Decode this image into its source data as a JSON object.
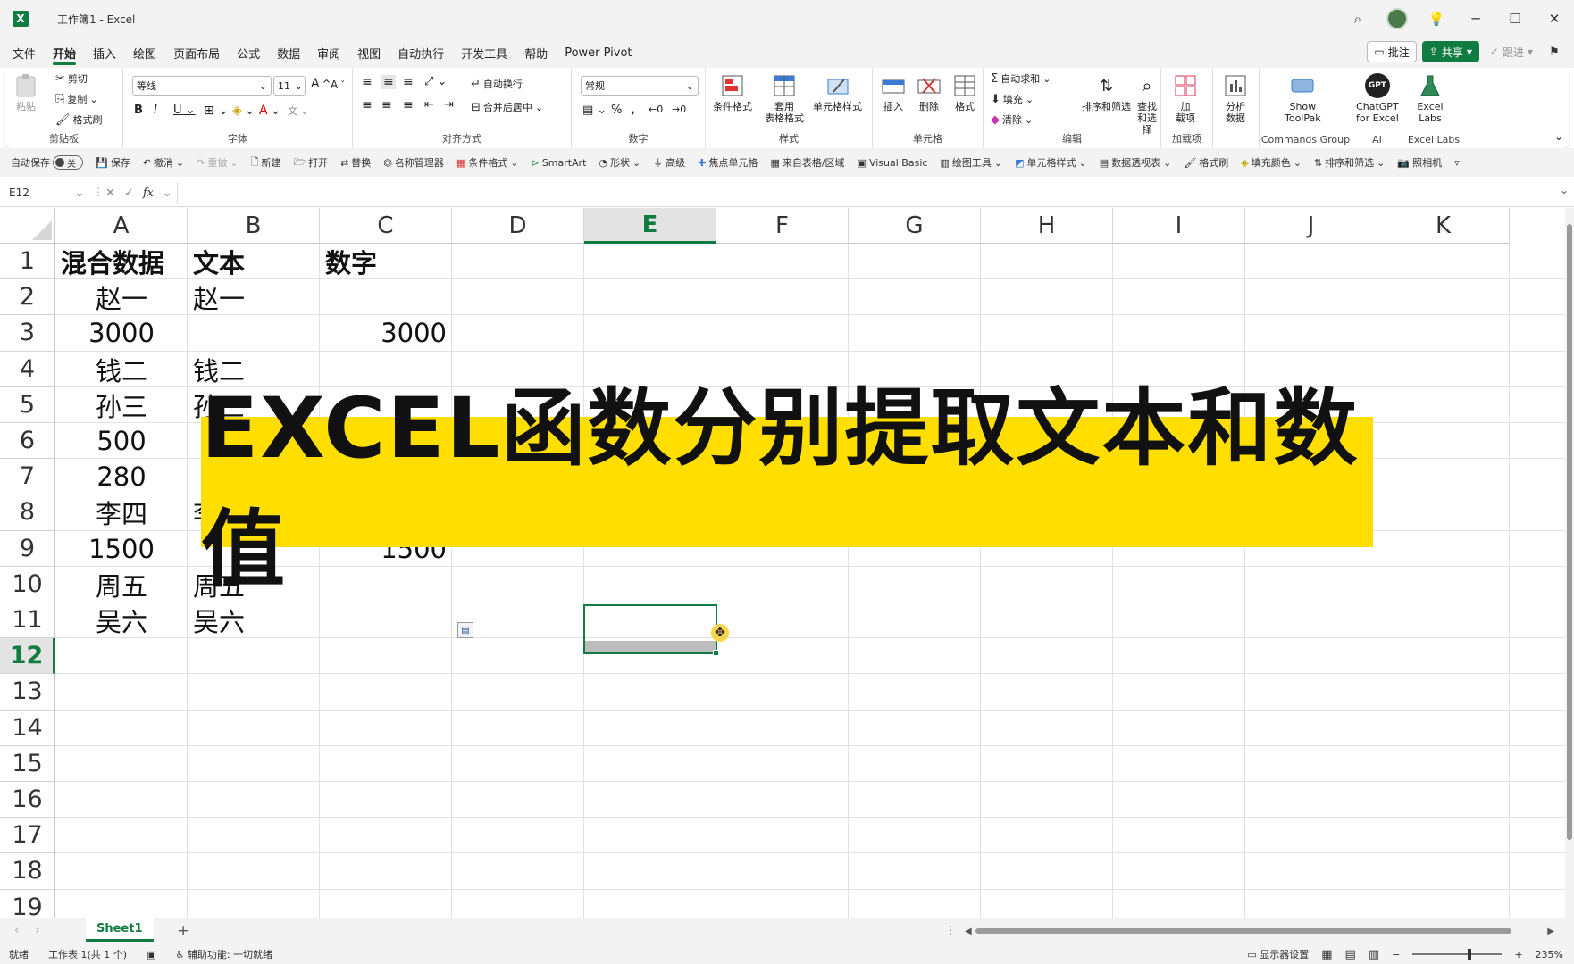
{
  "window": {
    "title": "工作簿1  -  Excel"
  },
  "menu": {
    "tabs": [
      "文件",
      "开始",
      "插入",
      "绘图",
      "页面布局",
      "公式",
      "数据",
      "审阅",
      "视图",
      "自动执行",
      "开发工具",
      "帮助",
      "Power Pivot"
    ],
    "comment": "批注",
    "share": "共享",
    "follow": "跟进"
  },
  "ribbon": {
    "clipboard": {
      "paste": "粘贴",
      "cut": "剪切",
      "copy": "复制",
      "format_painter": "格式刷",
      "label": "剪贴板"
    },
    "font": {
      "name": "等线",
      "size": "11",
      "label": "字体"
    },
    "alignment": {
      "wrap": "自动换行",
      "merge": "合并后居中",
      "label": "对齐方式"
    },
    "number": {
      "format": "常规",
      "label": "数字"
    },
    "styles": {
      "conditional": "条件格式",
      "table": "套用\n表格格式",
      "cell_styles": "单元格样式",
      "label": "样式"
    },
    "cells": {
      "insert": "插入",
      "delete": "删除",
      "format": "格式",
      "label": "单元格"
    },
    "editing": {
      "autosum": "自动求和",
      "fill": "填充",
      "clear": "清除",
      "sort": "排序和筛选",
      "find": "查找和选择",
      "label": "编辑"
    },
    "addins": {
      "btn": "加\n载项",
      "label": "加载项"
    },
    "analyze": {
      "btn": "分析\n数据"
    },
    "toolpak": {
      "btn": "Show\nToolPak",
      "label": "Commands Group"
    },
    "chatgpt": {
      "btn": "ChatGPT\nfor Excel",
      "label": "AI",
      "icon_text": "GPT"
    },
    "labs": {
      "btn": "Excel\nLabs",
      "label": "Excel Labs"
    }
  },
  "qat": {
    "autosave": "自动保存",
    "autosave_state": "关",
    "items": [
      "保存",
      "撤消",
      "重做",
      "新建",
      "打开",
      "替换",
      "名称管理器",
      "条件格式",
      "SmartArt",
      "形状",
      "高级",
      "焦点单元格",
      "来自表格/区域",
      "Visual Basic",
      "绘图工具",
      "单元格样式",
      "数据透视表",
      "格式刷",
      "填充颜色",
      "排序和筛选",
      "照相机"
    ]
  },
  "formula_bar": {
    "name_box": "E12",
    "fx": "fx",
    "value": ""
  },
  "grid": {
    "columns": [
      "A",
      "B",
      "C",
      "D",
      "E",
      "F",
      "G",
      "H",
      "I",
      "J",
      "K"
    ],
    "rows": [
      "1",
      "2",
      "3",
      "4",
      "5",
      "6",
      "7",
      "8",
      "9",
      "10",
      "11",
      "12",
      "13",
      "14",
      "15",
      "16",
      "17",
      "18",
      "19"
    ],
    "selected_col": "E",
    "selected_row": "12",
    "cells": {
      "A1": "混合数据",
      "B1": "文本",
      "C1": "数字",
      "A2": "赵一",
      "B2": "赵一",
      "A3": "3000",
      "C3": "3000",
      "A4": "钱二",
      "B4": "钱二",
      "A5": "孙三",
      "B5": "孙三",
      "A6": "500",
      "A7": "280",
      "A8": "李四",
      "B8": "李",
      "A9": "1500",
      "C9": "1500",
      "A10": "周五",
      "B10": "周五",
      "A11": "吴六",
      "B11": "吴六"
    }
  },
  "banner": {
    "text": "EXCEL函数分别提取文本和数值"
  },
  "sheets": {
    "tabs": [
      "Sheet1"
    ],
    "add": "+"
  },
  "status": {
    "ready": "就绪",
    "sheet_info": "工作表 1(共 1 个)",
    "accessibility": "辅助功能: 一切就绪",
    "display_settings": "显示器设置",
    "zoom": "235%"
  },
  "colors": {
    "accent": "#107c41",
    "banner": "#ffde00"
  }
}
